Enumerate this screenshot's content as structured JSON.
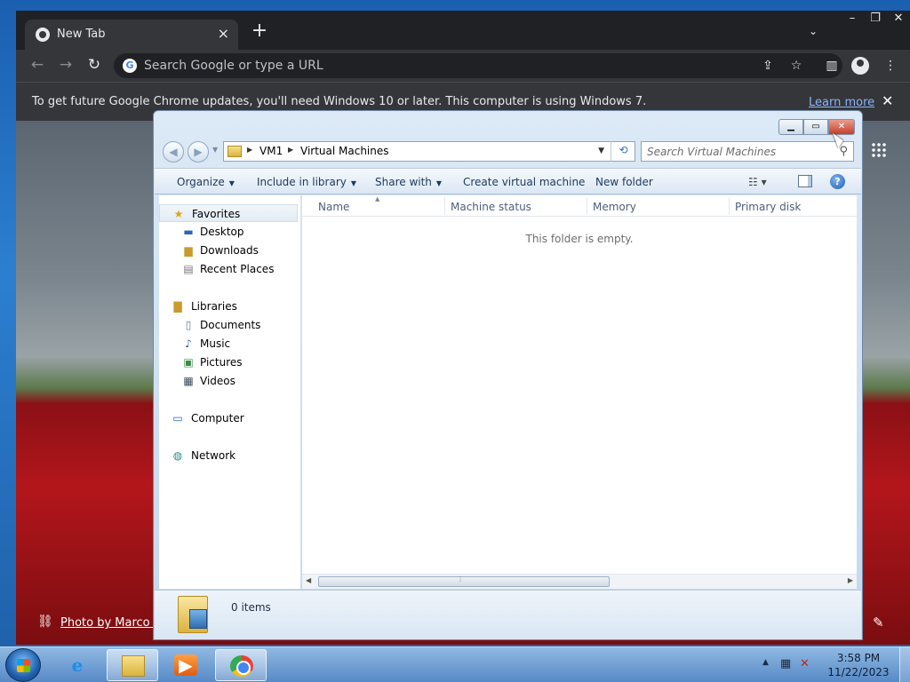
{
  "chrome": {
    "tab_title": "New Tab",
    "omnibox_placeholder": "Search Google or type a URL",
    "infobar_message": "To get future Google Chrome updates, you'll need Windows 10 or later. This computer is using Windows 7.",
    "infobar_link": "Learn more",
    "photo_credit": "Photo by Marco S"
  },
  "explorer": {
    "breadcrumb": [
      "VM1",
      "Virtual Machines"
    ],
    "search_placeholder": "Search Virtual Machines",
    "commands": {
      "organize": "Organize",
      "include_in_library": "Include in library",
      "share_with": "Share with",
      "create_vm": "Create virtual machine",
      "new_folder": "New folder"
    },
    "nav": {
      "favorites": "Favorites",
      "desktop": "Desktop",
      "downloads": "Downloads",
      "recent_places": "Recent Places",
      "libraries": "Libraries",
      "documents": "Documents",
      "music": "Music",
      "pictures": "Pictures",
      "videos": "Videos",
      "computer": "Computer",
      "network": "Network"
    },
    "columns": [
      "Name",
      "Machine status",
      "Memory",
      "Primary disk"
    ],
    "empty_message": "This folder is empty.",
    "item_count": "0 items"
  },
  "taskbar": {
    "time": "3:58 PM",
    "date": "11/22/2023"
  }
}
